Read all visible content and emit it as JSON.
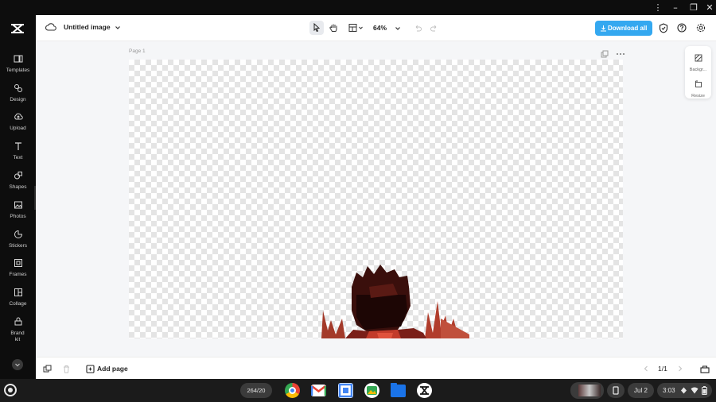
{
  "window": {},
  "sidebar": {
    "items": [
      {
        "label": "Templates",
        "icon": "templates-icon"
      },
      {
        "label": "Design",
        "icon": "design-icon"
      },
      {
        "label": "Upload",
        "icon": "upload-icon"
      },
      {
        "label": "Text",
        "icon": "text-icon"
      },
      {
        "label": "Shapes",
        "icon": "shapes-icon"
      },
      {
        "label": "Photos",
        "icon": "photos-icon"
      },
      {
        "label": "Stickers",
        "icon": "stickers-icon"
      },
      {
        "label": "Frames",
        "icon": "frames-icon"
      },
      {
        "label": "Collage",
        "icon": "collage-icon"
      },
      {
        "label": "Brand kit",
        "icon": "brand-kit-icon"
      }
    ]
  },
  "header": {
    "title": "Untitled image",
    "zoom": "64%",
    "download_label": "Download all",
    "accent": "#34a8f0"
  },
  "canvas": {
    "page_label": "Page 1"
  },
  "right_panel": {
    "background_label": "Backgr...",
    "resize_label": "Resize"
  },
  "bottom": {
    "add_page_label": "Add page",
    "page_counter": "1/1"
  },
  "taskbar": {
    "pill_label": "264/20",
    "date": "Jul 2",
    "time": "3:03"
  }
}
